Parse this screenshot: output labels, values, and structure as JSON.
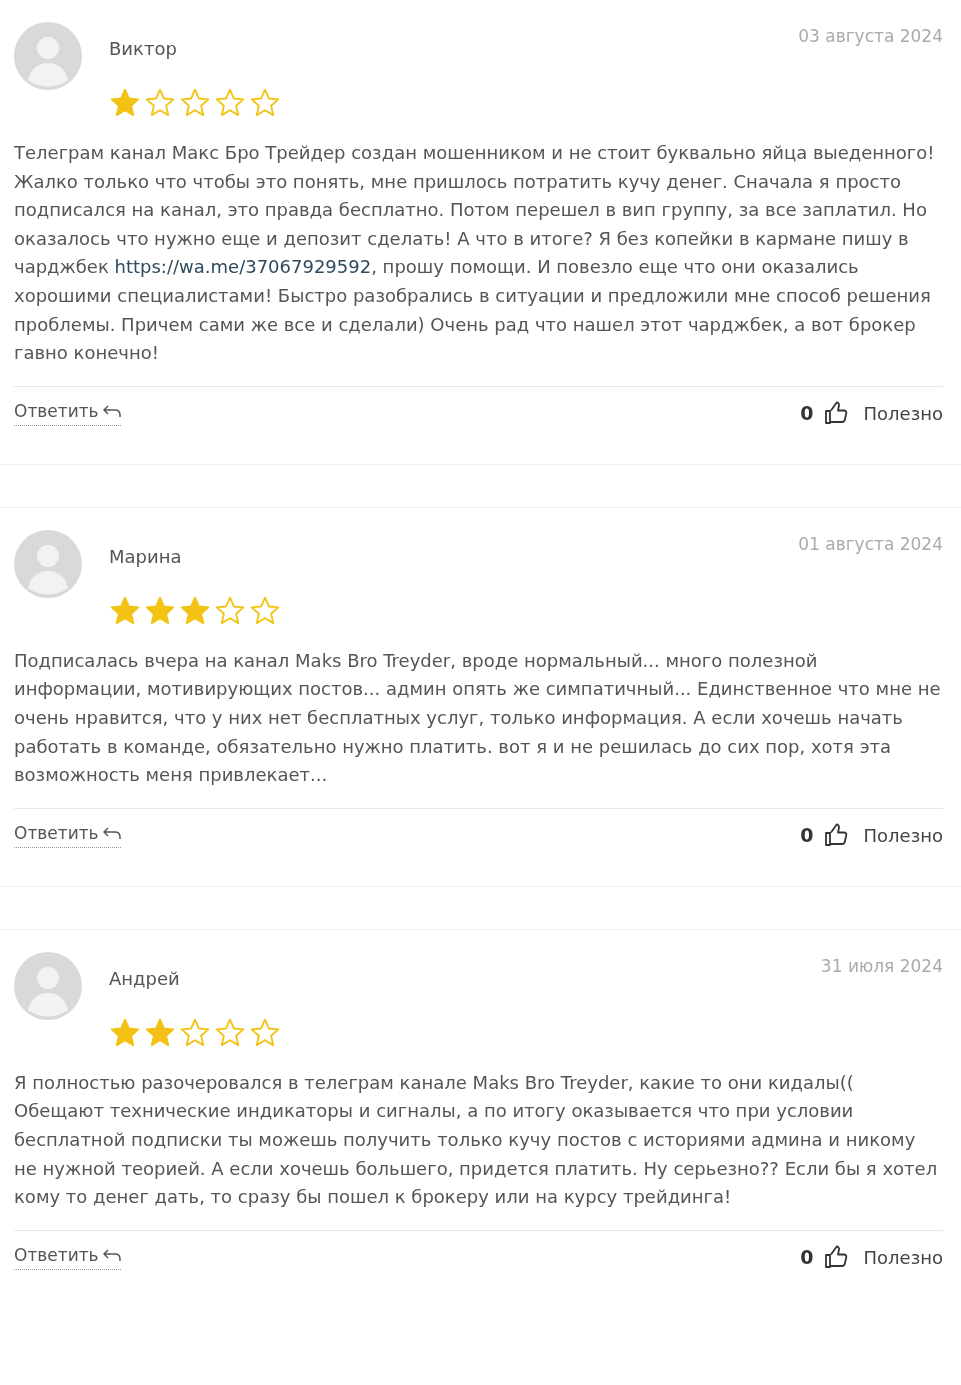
{
  "reviews": [
    {
      "author": "Виктор",
      "date": "03 августа 2024",
      "stars": 1,
      "body": [
        {
          "kind": "plain",
          "text": "Телеграм канал Макс Бро Трейдер создан мошенником и не стоит буквально яйца выеденного! Жалко только что чтобы это понять, мне пришлось потратить кучу денег. Сначала я просто подписался на канал, это правда бесплатно. Потом перешел в вип группу, за все заплатил. Но оказалось что нужно еще и депозит сделать! А что в итоге? Я без копейки в кармане пишу в чарджбек "
        },
        {
          "kind": "link",
          "text": "https://wa.me/37067929592"
        },
        {
          "kind": "plain",
          "text": ", прошу помощи. И повезло еще что они оказались хорошими специалистами! Быстро разобрались в ситуации и предложили мне способ решения проблемы. Причем сами же все и сделали) Очень рад что нашел этот чарджбек, а вот брокер гавно конечно!"
        }
      ],
      "reply": "Ответить",
      "likes": "0",
      "useful": "Полезно"
    },
    {
      "author": "Марина",
      "date": "01 августа 2024",
      "stars": 3,
      "body": [
        {
          "kind": "plain",
          "text": "Подписалась вчера на канал Maks Bro Treyder, вроде нормальный... много полезной информации, мотивирующих постов... админ опять же симпатичный... Единственное что мне не очень нравится, что у них нет бесплатных услуг, только информация. А если хочешь начать работать в команде, обязательно нужно платить. вот я и не решилась до сих пор, хотя эта возможность меня привлекает..."
        }
      ],
      "reply": "Ответить",
      "likes": "0",
      "useful": "Полезно"
    },
    {
      "author": "Андрей",
      "date": "31 июля 2024",
      "stars": 2,
      "body": [
        {
          "kind": "plain",
          "text": "Я полностью разочеровался в телеграм канале Maks Bro Treyder, какие то они кидалы(( Обещают технические индикаторы и сигналы, а по итогу оказывается что при условии бесплатной подписки ты можешь получить только кучу постов с историями админа и никому не нужной теорией. А если хочешь большего, придется платить. Ну серьезно?? Если бы я хотел кому то денег дать, то сразу бы пошел к брокеру или на курсу трейдинга!"
        }
      ],
      "reply": "Ответить",
      "likes": "0",
      "useful": "Полезно"
    }
  ]
}
